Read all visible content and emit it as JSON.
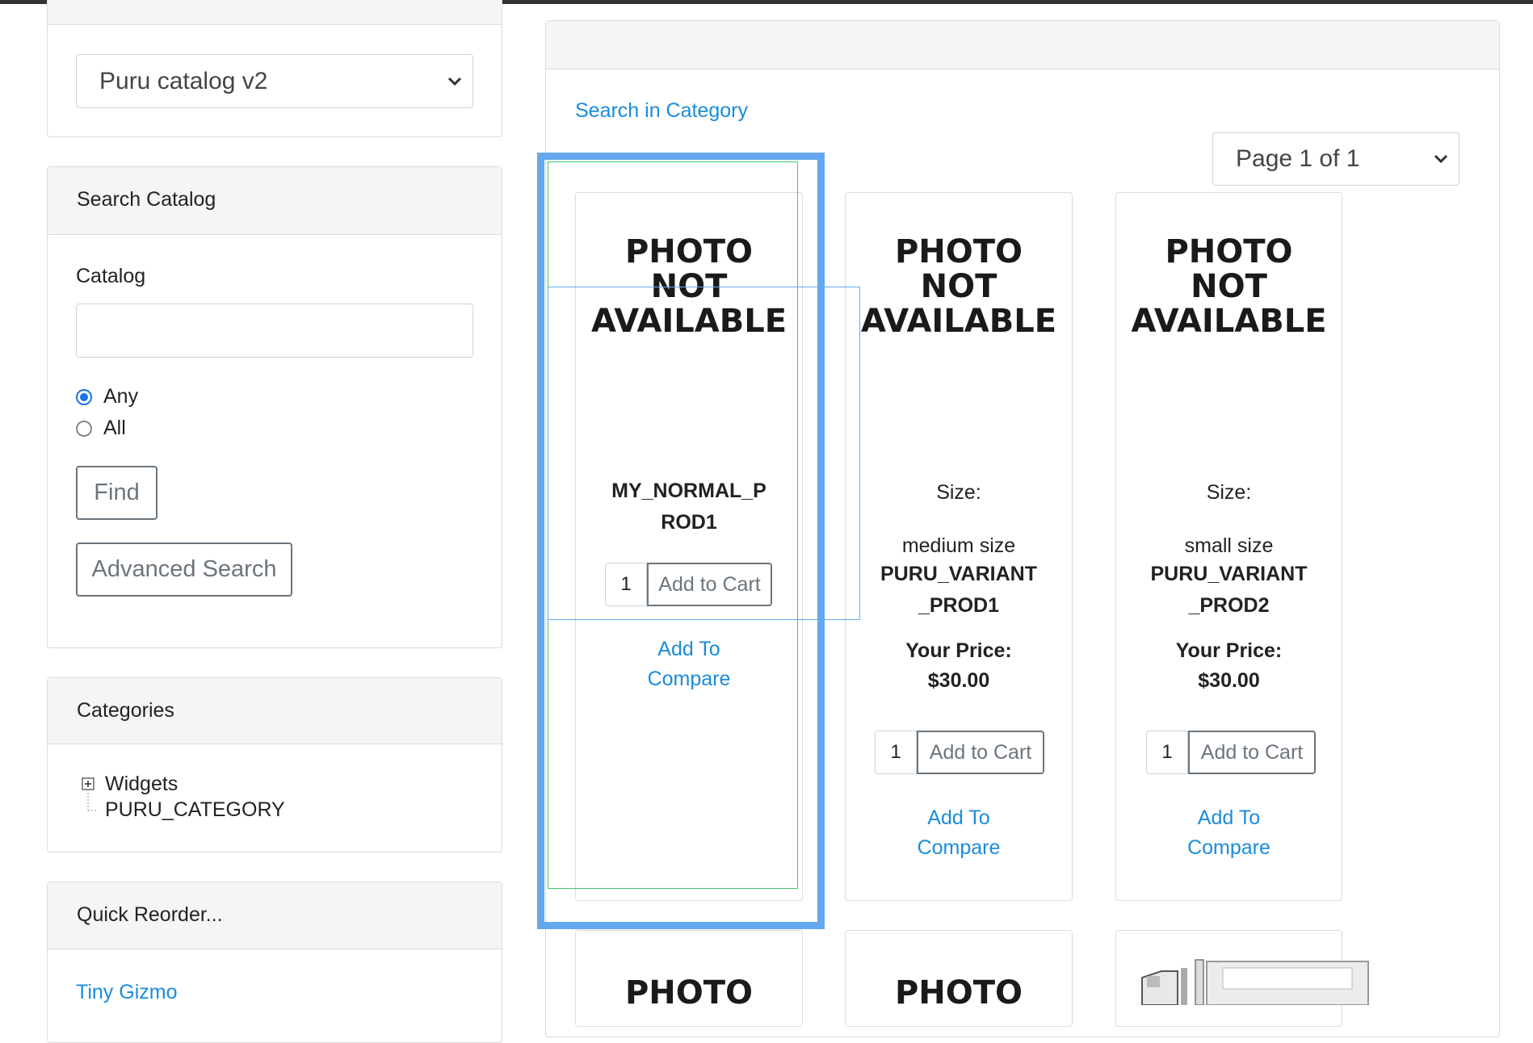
{
  "catalog_select": {
    "selected": "Puru catalog v2"
  },
  "search_catalog": {
    "title": "Search Catalog",
    "catalog_label": "Catalog",
    "catalog_value": "",
    "radio_any": "Any",
    "radio_all": "All",
    "selected_radio": "Any",
    "find_label": "Find",
    "advanced_label": "Advanced Search"
  },
  "categories": {
    "title": "Categories",
    "items": [
      "Widgets",
      "PURU_CATEGORY"
    ]
  },
  "quick_reorder": {
    "title": "Quick Reorder...",
    "items": [
      "Tiny Gizmo"
    ]
  },
  "main": {
    "search_link": "Search in Category",
    "page_select": "Page 1 of 1",
    "photo_placeholder_line1": "PHOTO",
    "photo_placeholder_line2": "NOT",
    "photo_placeholder_line3": "AVAILABLE",
    "products": [
      {
        "id_line1": "MY_NORMAL_P",
        "id_line2": "ROD1",
        "qty": "1",
        "add_to_cart": "Add to Cart",
        "compare_line1": "Add To",
        "compare_line2": "Compare"
      },
      {
        "size_label": "Size:",
        "size_value": "medium size",
        "id_line1": "PURU_VARIANT",
        "id_line2": "_PROD1",
        "price_label": "Your Price:",
        "price": "$30.00",
        "qty": "1",
        "add_to_cart": "Add to Cart",
        "compare_line1": "Add To",
        "compare_line2": "Compare"
      },
      {
        "size_label": "Size:",
        "size_value": "small size",
        "id_line1": "PURU_VARIANT",
        "id_line2": "_PROD2",
        "price_label": "Your Price:",
        "price": "$30.00",
        "qty": "1",
        "add_to_cart": "Add to Cart",
        "compare_line1": "Add To",
        "compare_line2": "Compare"
      }
    ],
    "bottom_products": [
      {
        "photo_line1": "PHOTO"
      },
      {
        "photo_line1": "PHOTO"
      },
      {
        "image": "truck-image"
      }
    ]
  },
  "colors": {
    "link": "#1a8cdb",
    "highlight_blue": "#64a8f0",
    "highlight_green": "#3cc864",
    "header_bg": "#f5f5f5"
  }
}
